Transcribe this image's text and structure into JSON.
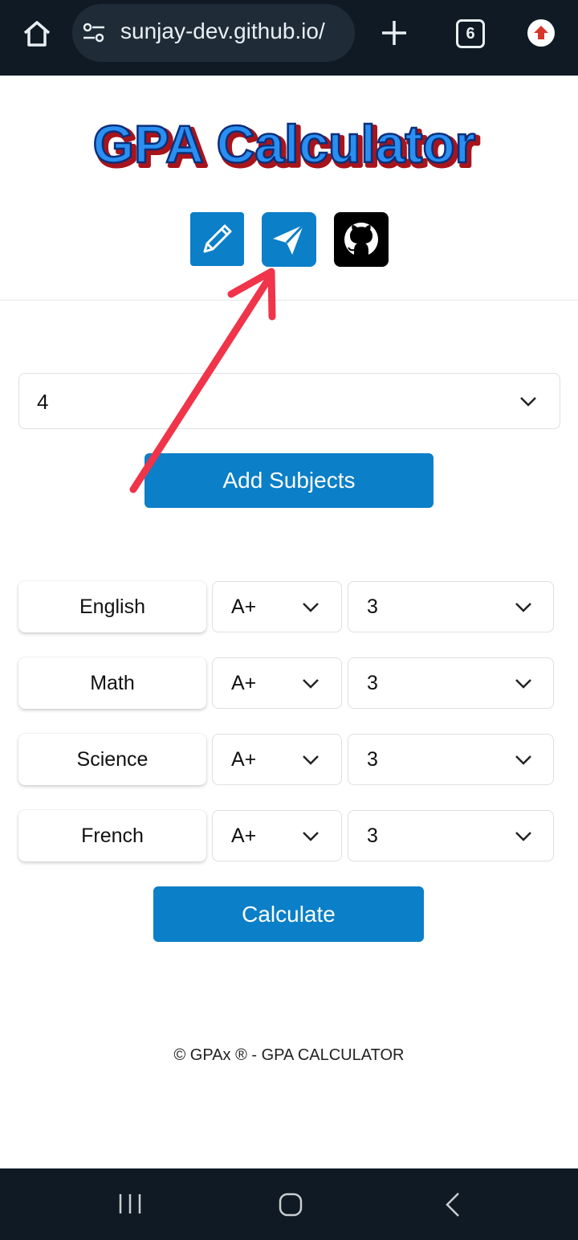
{
  "browser": {
    "url": "sunjay-dev.github.io/",
    "tab_count": "6",
    "icons": [
      "home-icon",
      "site-settings-icon",
      "new-tab-plus-icon",
      "tab-switcher-icon",
      "update-icon"
    ]
  },
  "header": {
    "logo_text": "GPA Calculator",
    "icon_buttons": [
      "edit-icon",
      "send-icon",
      "github-icon"
    ]
  },
  "subject_count": {
    "selected": "4"
  },
  "add_subjects_label": "Add Subjects",
  "subjects": [
    {
      "name": "English",
      "grade": "A+",
      "credit": "3"
    },
    {
      "name": "Math",
      "grade": "A+",
      "credit": "3"
    },
    {
      "name": "Science",
      "grade": "A+",
      "credit": "3"
    },
    {
      "name": "French",
      "grade": "A+",
      "credit": "3"
    }
  ],
  "calculate_label": "Calculate",
  "footer": "© GPAx ® - GPA CALCULATOR",
  "colors": {
    "primary": "#0b7fc7",
    "browser_bar": "#0f1a24",
    "annotation_arrow": "#f0344a"
  },
  "navbar_icons": [
    "recent-apps-icon",
    "home-button-icon",
    "back-icon"
  ]
}
